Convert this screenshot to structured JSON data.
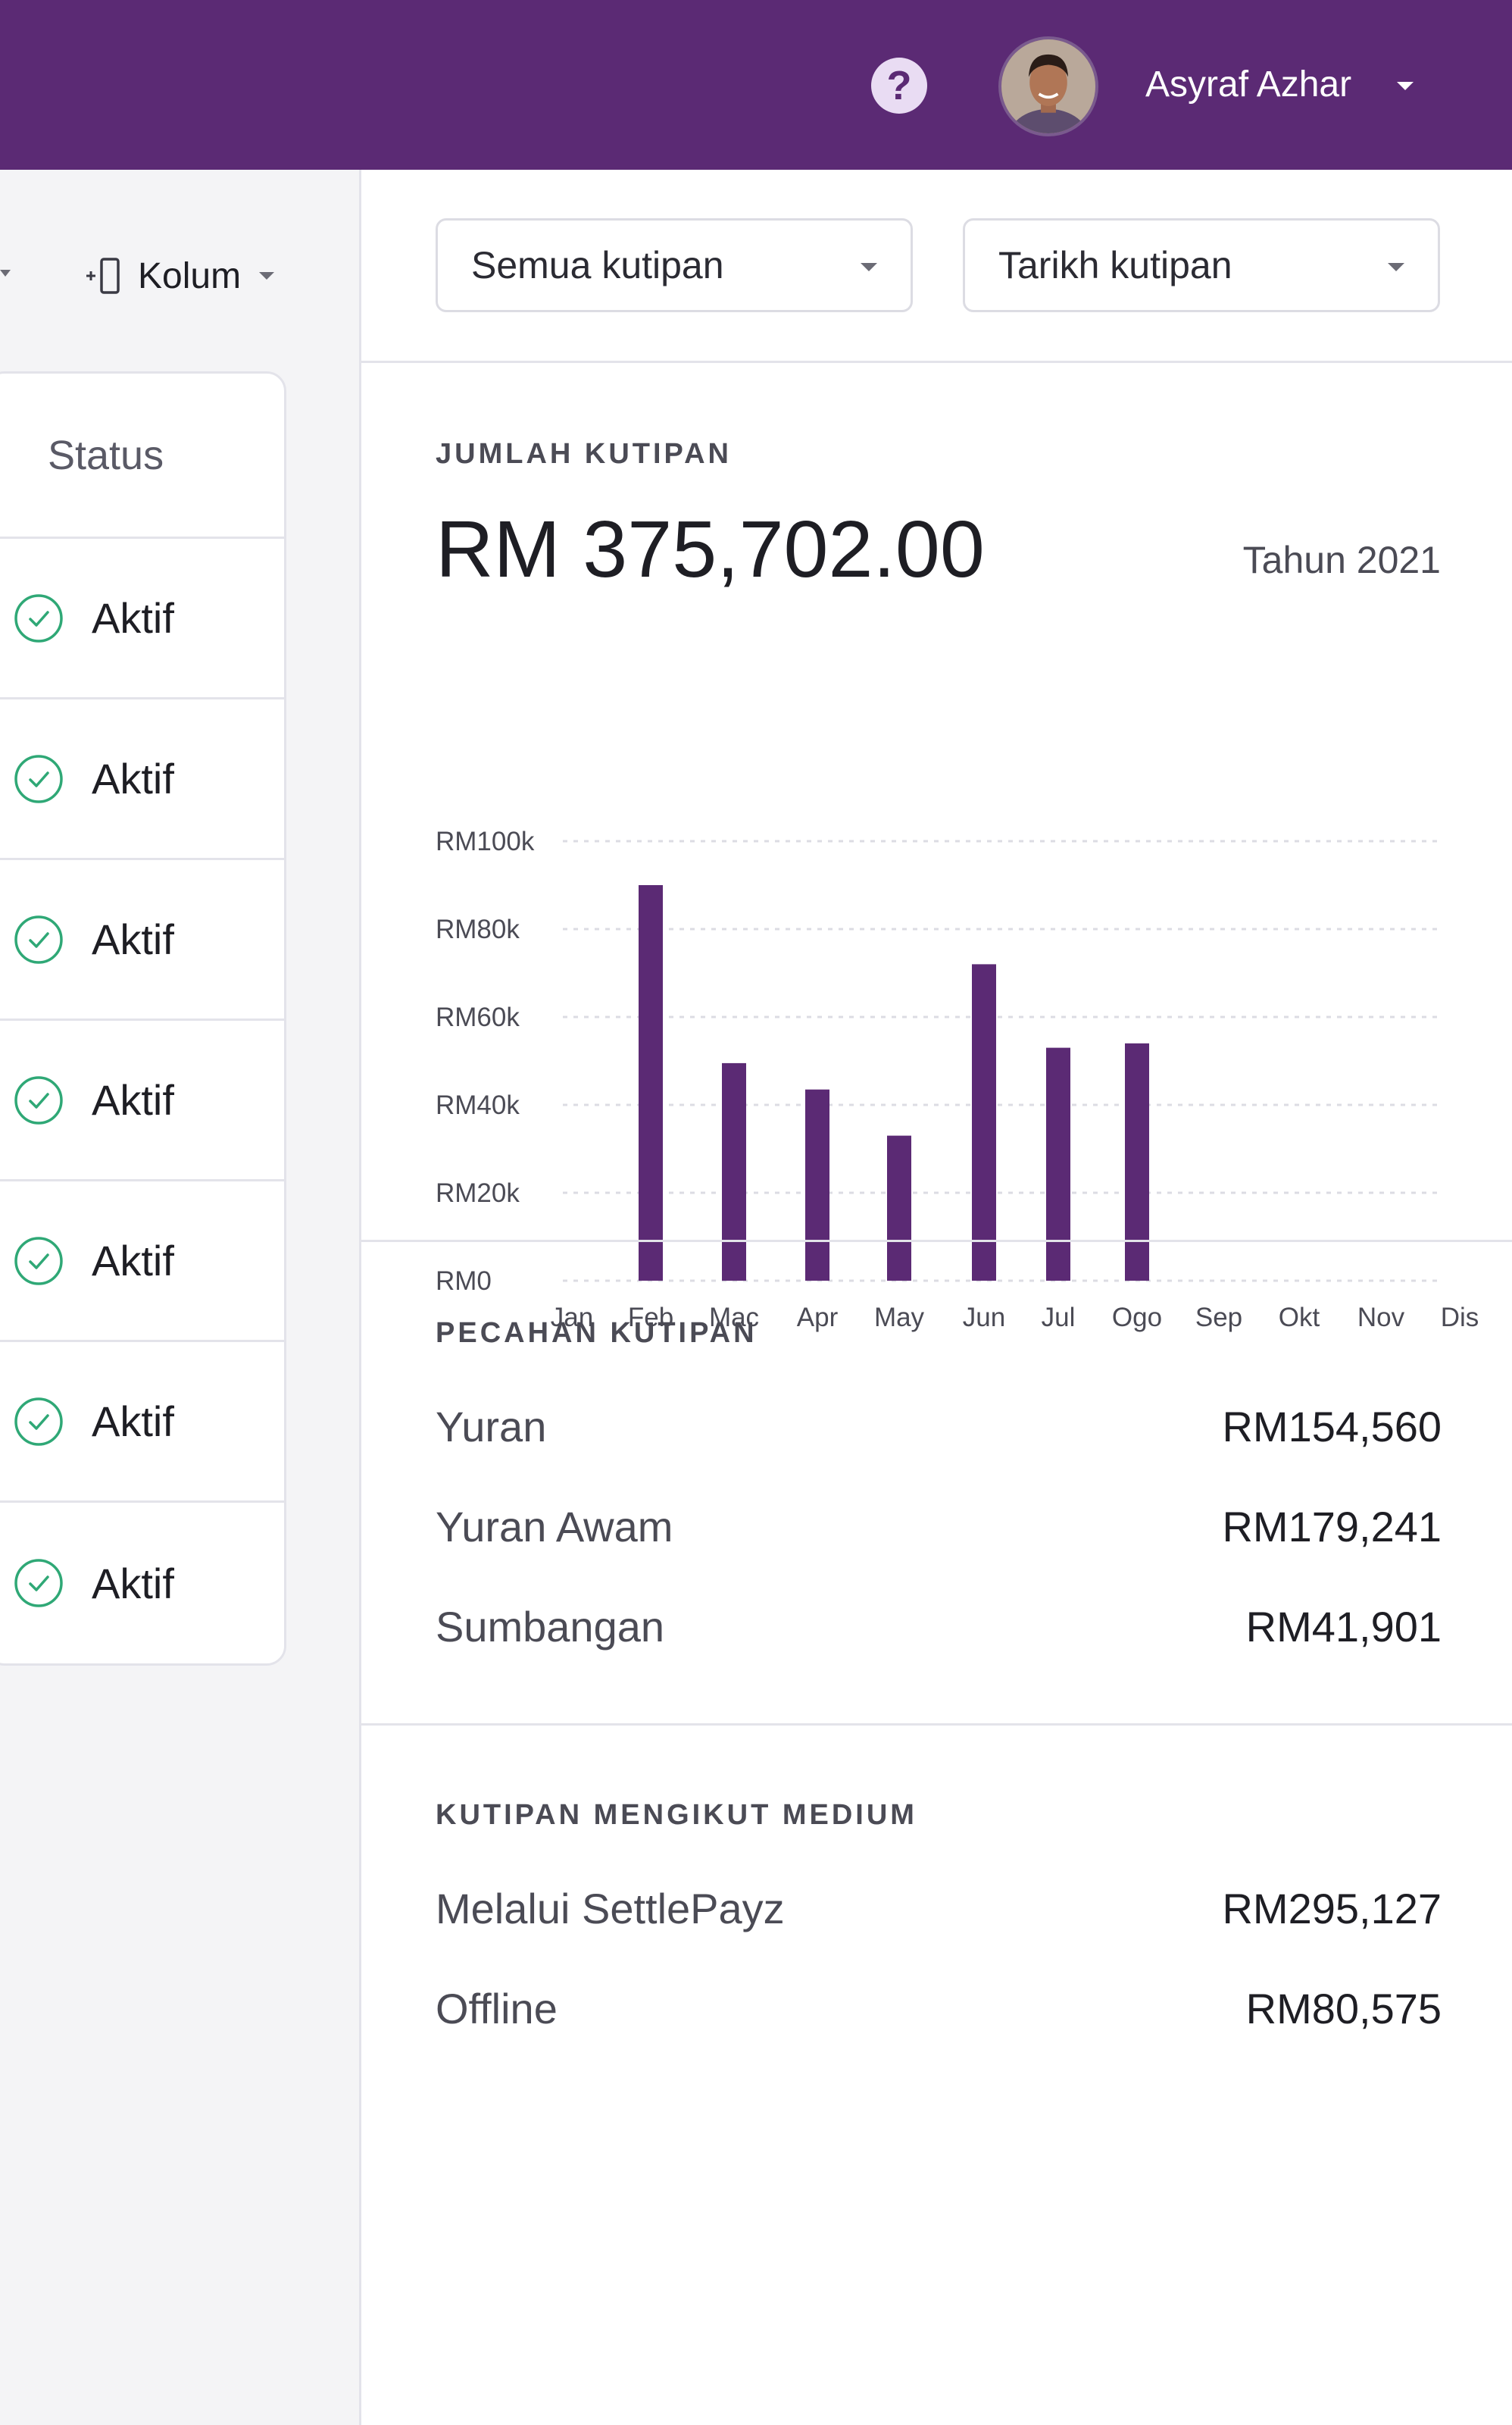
{
  "header": {
    "help_icon": "question-circle-icon",
    "user_name": "Asyraf Azhar"
  },
  "toolbar": {
    "kolum_label": "Kolum"
  },
  "status_table": {
    "header": "Status",
    "rows": [
      "Aktif",
      "Aktif",
      "Aktif",
      "Aktif",
      "Aktif",
      "Aktif",
      "Aktif"
    ],
    "status_color": "#2fa876"
  },
  "filters": {
    "collection_type": "Semua kutipan",
    "collection_date": "Tarikh kutipan"
  },
  "summary": {
    "label": "JUMLAH KUTIPAN",
    "total": "RM 375,702.00",
    "year": "Tahun 2021"
  },
  "chart_data": {
    "type": "bar",
    "categories": [
      "Jan",
      "Feb",
      "Mac",
      "Apr",
      "May",
      "Jun",
      "Jul",
      "Ogo",
      "Sep",
      "Okt",
      "Nov",
      "Dis"
    ],
    "values": [
      0,
      90000,
      49500,
      43500,
      33000,
      72000,
      53000,
      54000,
      0,
      0,
      0,
      0
    ],
    "y_ticks": [
      "RM0",
      "RM20k",
      "RM40k",
      "RM60k",
      "RM80k",
      "RM100k"
    ],
    "ylim": [
      0,
      100000
    ],
    "bar_color": "#5b2a74",
    "grid": true
  },
  "breakdown": {
    "label": "PECAHAN KUTIPAN",
    "items": [
      {
        "name": "Yuran",
        "amount": "RM154,560"
      },
      {
        "name": "Yuran Awam",
        "amount": "RM179,241"
      },
      {
        "name": "Sumbangan",
        "amount": "RM41,901"
      }
    ]
  },
  "by_medium": {
    "label": "KUTIPAN MENGIKUT MEDIUM",
    "items": [
      {
        "name": "Melalui SettlePayz",
        "amount": "RM295,127"
      },
      {
        "name": "Offline",
        "amount": "RM80,575"
      }
    ]
  },
  "colors": {
    "brand": "#5b2a74",
    "help_bg": "#e9dcf3"
  }
}
